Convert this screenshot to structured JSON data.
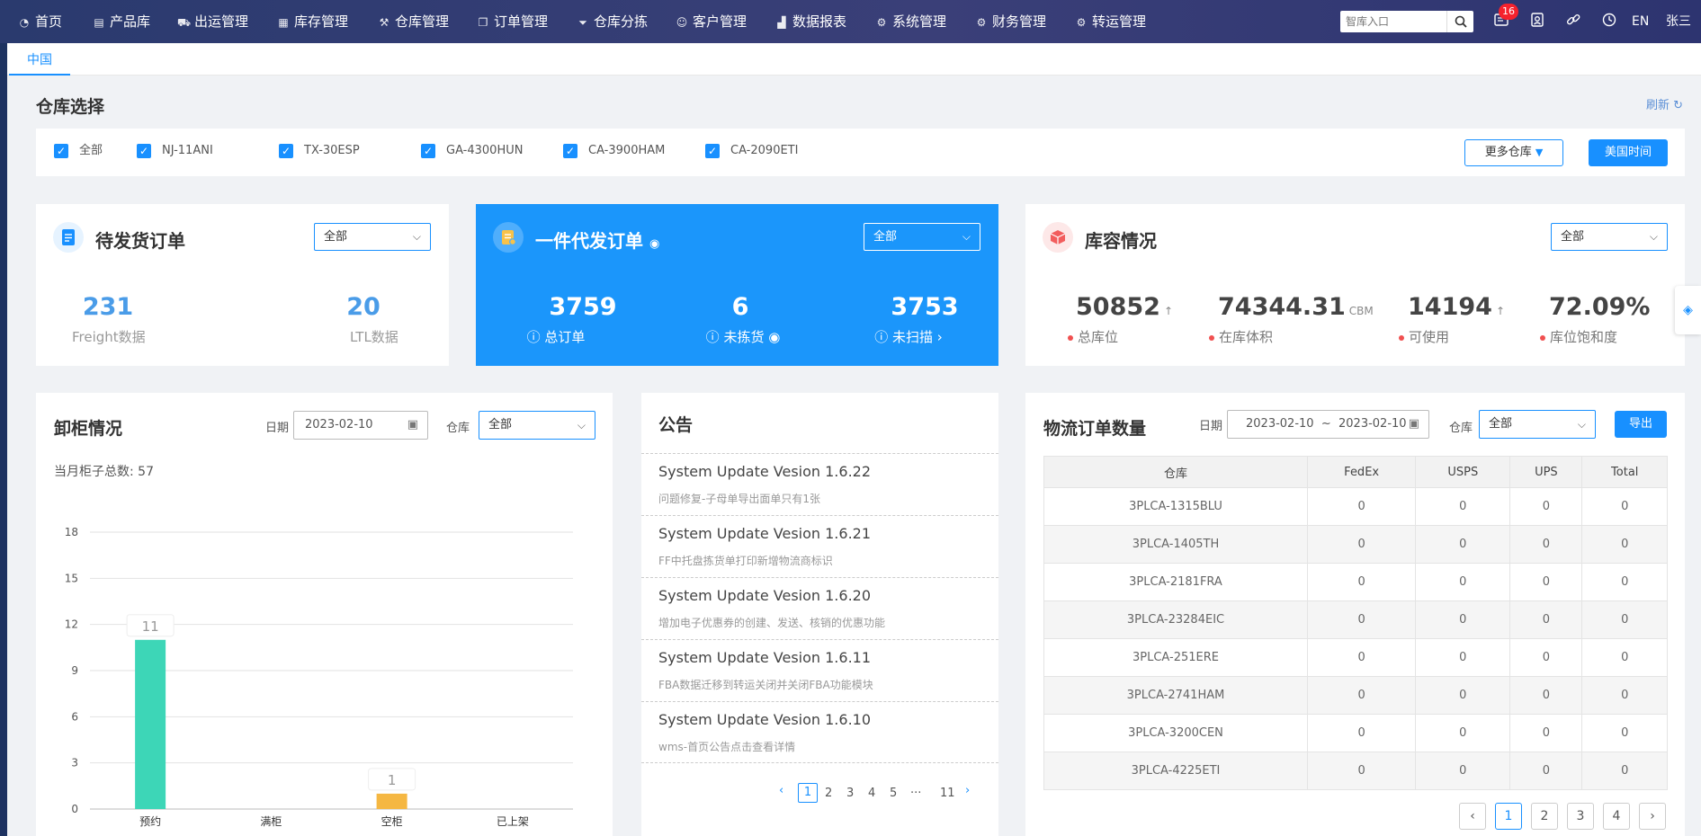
{
  "nav": {
    "items": [
      {
        "label": "首页",
        "icon": "dashboard-icon",
        "glyph": "◔"
      },
      {
        "label": "产品库",
        "icon": "box-icon",
        "glyph": "▤"
      },
      {
        "label": "出运管理",
        "icon": "truck-icon",
        "glyph": "⛟"
      },
      {
        "label": "库存管理",
        "icon": "inventory-icon",
        "glyph": "▦"
      },
      {
        "label": "仓库管理",
        "icon": "wrench-icon",
        "glyph": "⚒"
      },
      {
        "label": "订单管理",
        "icon": "order-icon",
        "glyph": "❐"
      },
      {
        "label": "仓库分拣",
        "icon": "filter-icon",
        "glyph": "⏷"
      },
      {
        "label": "客户管理",
        "icon": "customer-icon",
        "glyph": "☺"
      },
      {
        "label": "数据报表",
        "icon": "chart-icon",
        "glyph": "▟"
      },
      {
        "label": "系统管理",
        "icon": "gear-icon",
        "glyph": "⚙"
      },
      {
        "label": "财务管理",
        "icon": "finance-gear-icon",
        "glyph": "⚙"
      },
      {
        "label": "转运管理",
        "icon": "transfer-gear-icon",
        "glyph": "⚙"
      }
    ],
    "search_placeholder": "智库入口",
    "badge_count": "16",
    "lang": "EN",
    "user": "张三"
  },
  "tabs": {
    "active": "中国"
  },
  "warehouse": {
    "title": "仓库选择",
    "refresh": "刷新 ↻",
    "options": [
      "全部",
      "NJ-11ANI",
      "TX-30ESP",
      "GA-4300HUN",
      "CA-3900HAM",
      "CA-2090ETI"
    ],
    "more_label": "更多仓库",
    "time_label": "美国时间"
  },
  "pending": {
    "title": "待发货订单",
    "select": "全部",
    "freight_value": "231",
    "freight_label": "Freight数据",
    "ltl_value": "20",
    "ltl_label": "LTL数据"
  },
  "dropship": {
    "title": "一件代发订单",
    "select": "全部",
    "total_value": "3759",
    "total_label": "总订单",
    "unpicked_value": "6",
    "unpicked_label": "未拣货",
    "unscanned_value": "3753",
    "unscanned_label": "未扫描"
  },
  "inventory": {
    "title": "库容情况",
    "select": "全部",
    "total_slots": "50852",
    "total_slots_label": "总库位",
    "volume": "74344.31",
    "volume_unit": "CBM",
    "volume_label": "在库体积",
    "available": "14194",
    "available_label": "可使用",
    "saturation": "72.09%",
    "saturation_label": "库位饱和度"
  },
  "unload": {
    "title": "卸柜情况",
    "date_label": "日期",
    "date": "2023-02-10",
    "warehouse_label": "仓库",
    "warehouse": "全部",
    "summary": "当月柜子总数: 57"
  },
  "chart_data": {
    "type": "bar",
    "categories": [
      "预约",
      "满柜",
      "空柜",
      "已上架"
    ],
    "values": [
      11,
      0,
      1,
      0
    ],
    "ylim": [
      0,
      18
    ],
    "yticks": [
      "18",
      "15",
      "12",
      "9",
      "6",
      "3",
      "0"
    ],
    "bar_colors": [
      "#3dd6b7",
      "#3dd6b7",
      "#f5b742",
      "#3dd6b7"
    ],
    "value_labels": [
      "11",
      "",
      "1",
      ""
    ],
    "grid": true
  },
  "notice": {
    "title": "公告",
    "items": [
      {
        "title": "System Update Vesion 1.6.22",
        "sub": "问题修复-子母单导出面单只有1张"
      },
      {
        "title": "System Update Vesion 1.6.21",
        "sub": "FF中托盘拣货单打印新增物流商标识"
      },
      {
        "title": "System Update Vesion 1.6.20",
        "sub": "增加电子优惠券的创建、发送、核销的优惠功能"
      },
      {
        "title": "System Update Vesion 1.6.11",
        "sub": "FBA数据迁移到转运关闭并关闭FBA功能模块"
      },
      {
        "title": "System Update Vesion 1.6.10",
        "sub": "wms-首页公告点击查看详情"
      }
    ],
    "pages": [
      "1",
      "2",
      "3",
      "4",
      "5",
      "···",
      "11"
    ]
  },
  "logistics": {
    "title": "物流订单数量",
    "date_label": "日期",
    "date_from": "2023-02-10",
    "date_sep": "~",
    "date_to": "2023-02-10",
    "warehouse_label": "仓库",
    "warehouse": "全部",
    "export": "导出",
    "columns": [
      "仓库",
      "FedEx",
      "USPS",
      "UPS",
      "Total"
    ],
    "rows": [
      [
        "3PLCA-1315BLU",
        "0",
        "0",
        "0",
        "0"
      ],
      [
        "3PLCA-1405TH",
        "0",
        "0",
        "0",
        "0"
      ],
      [
        "3PLCA-2181FRA",
        "0",
        "0",
        "0",
        "0"
      ],
      [
        "3PLCA-23284EIC",
        "0",
        "0",
        "0",
        "0"
      ],
      [
        "3PLCA-251ERE",
        "0",
        "0",
        "0",
        "0"
      ],
      [
        "3PLCA-2741HAM",
        "0",
        "0",
        "0",
        "0"
      ],
      [
        "3PLCA-3200CEN",
        "0",
        "0",
        "0",
        "0"
      ],
      [
        "3PLCA-4225ETI",
        "0",
        "0",
        "0",
        "0"
      ]
    ],
    "pages": [
      "1",
      "2",
      "3",
      "4"
    ]
  }
}
